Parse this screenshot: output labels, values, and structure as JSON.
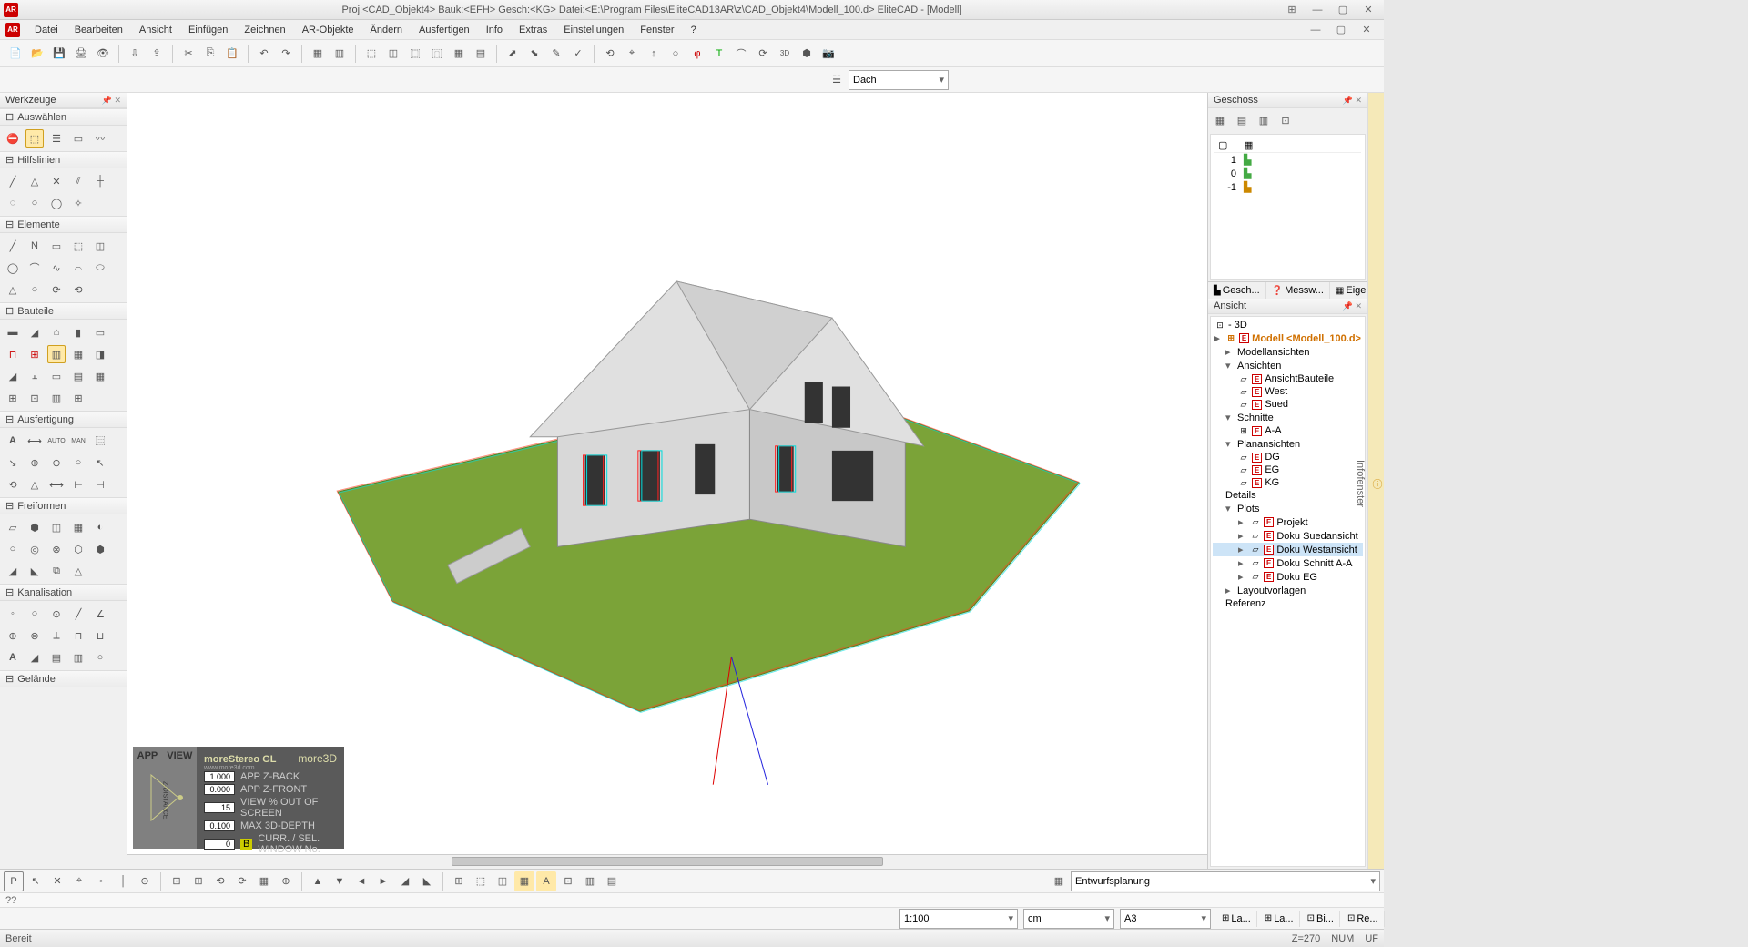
{
  "title": "Proj:<CAD_Objekt4>  Bauk:<EFH>  Gesch:<KG>  Datei:<E:\\Program Files\\EliteCAD13AR\\z\\CAD_Objekt4\\Modell_100.d>  EliteCAD - [Modell]",
  "menu": [
    "Datei",
    "Bearbeiten",
    "Ansicht",
    "Einfügen",
    "Zeichnen",
    "AR-Objekte",
    "Ändern",
    "Ausfertigen",
    "Info",
    "Extras",
    "Einstellungen",
    "Fenster",
    "?"
  ],
  "layer_combo": "Dach",
  "left_panel_title": "Werkzeuge",
  "sections": {
    "auswaehlen": "Auswählen",
    "hilfslinien": "Hilfslinien",
    "elemente": "Elemente",
    "bauteile": "Bauteile",
    "ausfertigung": "Ausfertigung",
    "freiformen": "Freiformen",
    "kanalisation": "Kanalisation",
    "gelaende": "Gelände"
  },
  "geschoss": {
    "title": "Geschoss",
    "levels": [
      {
        "n": "1",
        "ico": "▙"
      },
      {
        "n": "0",
        "ico": "▙"
      },
      {
        "n": "-1",
        "ico": "▙"
      }
    ],
    "tabs": [
      "Gesch...",
      "Messw...",
      "Eigens..."
    ]
  },
  "ansicht": {
    "title": "Ansicht",
    "root": "- 3D",
    "model": "Modell <Modell_100.d>",
    "groups": {
      "modellansichten": "Modellansichten",
      "ansichten": "Ansichten",
      "schnitte": "Schnitte",
      "planansichten": "Planansichten",
      "details": "Details",
      "plots": "Plots",
      "layoutvorlagen": "Layoutvorlagen",
      "referenz": "Referenz"
    },
    "ansichten_items": [
      "AnsichtBauteile",
      "West",
      "Sued"
    ],
    "schnitte_items": [
      "A-A"
    ],
    "plan_items": [
      "DG",
      "EG",
      "KG"
    ],
    "plots_items": [
      "Projekt",
      "Doku Suedansicht",
      "Doku Westansicht",
      "Doku Schnitt A-A",
      "Doku EG"
    ]
  },
  "bottom": {
    "phase": "Entwurfsplanung",
    "scale": "1:100",
    "unit": "cm",
    "format": "A3"
  },
  "stereo": {
    "brand_top": "moreStereo GL",
    "brand_sub": "www.more3d.com",
    "brand_right": "more3D",
    "rows": [
      {
        "v": "1.000",
        "l": "APP Z-BACK"
      },
      {
        "v": "0.000",
        "l": "APP Z-FRONT"
      },
      {
        "v": "15",
        "l": "VIEW % OUT OF SCREEN"
      },
      {
        "v": "0.100",
        "l": "MAX 3D-DEPTH"
      },
      {
        "v": "0",
        "l": "CURR. / SEL. WINDOW No."
      }
    ],
    "left_labels": [
      "APP",
      "VIEW"
    ],
    "zlabel": "Z-DISTANCE"
  },
  "status": {
    "ready": "Bereit",
    "layer_tabs": [
      "La...",
      "La...",
      "Bi...",
      "Re..."
    ],
    "z": "Z=270",
    "num": "NUM",
    "uf": "UF"
  },
  "cmd": "??",
  "info_label": "Infofenster"
}
